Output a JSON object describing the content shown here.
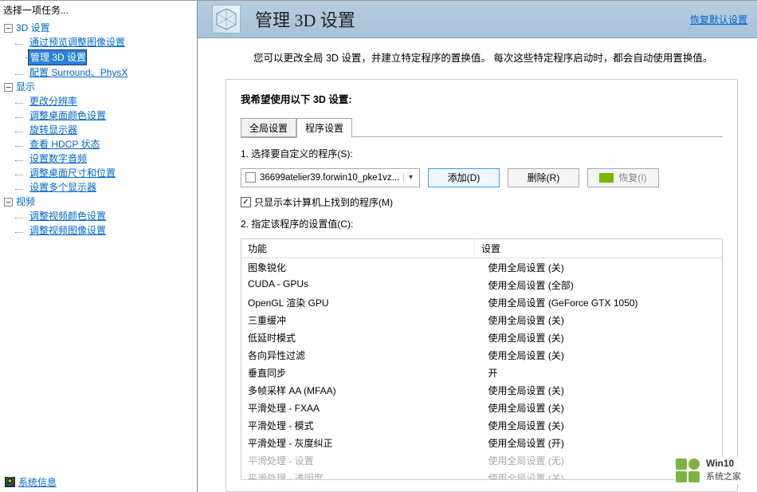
{
  "sidebar": {
    "header": "选择一项任务...",
    "categories": [
      {
        "label": "3D 设置",
        "items": [
          {
            "label": "通过预览调整图像设置"
          },
          {
            "label": "管理 3D 设置",
            "selected": true
          },
          {
            "label": "配置 Surround、PhysX"
          }
        ]
      },
      {
        "label": "显示",
        "items": [
          {
            "label": "更改分辨率"
          },
          {
            "label": "调整桌面颜色设置"
          },
          {
            "label": "旋转显示器"
          },
          {
            "label": "查看 HDCP 状态"
          },
          {
            "label": "设置数字音频"
          },
          {
            "label": "调整桌面尺寸和位置"
          },
          {
            "label": "设置多个显示器"
          }
        ]
      },
      {
        "label": "视频",
        "items": [
          {
            "label": "调整视频颜色设置"
          },
          {
            "label": "调整视频图像设置"
          }
        ]
      }
    ],
    "sysinfo": "系统信息"
  },
  "page": {
    "title": "管理 3D 设置",
    "restore": "恢复默认设置",
    "description": "您可以更改全局 3D 设置，并建立特定程序的置换值。  每次这些特定程序启动时，都会自动使用置换值。"
  },
  "panel": {
    "heading": "我希望使用以下 3D 设置:",
    "tabs": [
      "全局设置",
      "程序设置"
    ],
    "active_tab": 1,
    "step1": "1. 选择要自定义的程序(S):",
    "program": "36699atelier39.forwin10_pke1vz...",
    "btn_add": "添加(D)",
    "btn_remove": "删除(R)",
    "btn_restore": "恢复(I)",
    "checkbox": "只显示本计算机上找到的程序(M)",
    "checkbox_checked": true,
    "step2": "2. 指定该程序的设置值(C):",
    "headers": [
      "功能",
      "设置"
    ],
    "settings": [
      {
        "name": "图象锐化",
        "value": "使用全局设置 (关)"
      },
      {
        "name": "CUDA - GPUs",
        "value": "使用全局设置 (全部)"
      },
      {
        "name": "OpenGL 渲染 GPU",
        "value": "使用全局设置 (GeForce GTX 1050)"
      },
      {
        "name": "三重缓冲",
        "value": "使用全局设置 (关)"
      },
      {
        "name": "低延时模式",
        "value": "使用全局设置 (关)"
      },
      {
        "name": "各向异性过滤",
        "value": "使用全局设置 (关)"
      },
      {
        "name": "垂直同步",
        "value": "开"
      },
      {
        "name": "多帧采样 AA (MFAA)",
        "value": "使用全局设置 (关)"
      },
      {
        "name": "平滑处理 - FXAA",
        "value": "使用全局设置 (关)"
      },
      {
        "name": "平滑处理 - 模式",
        "value": "使用全局设置 (关)"
      },
      {
        "name": "平滑处理 - 灰度纠正",
        "value": "使用全局设置 (开)"
      },
      {
        "name": "平滑处理 - 设置",
        "value": "使用全局设置 (无)",
        "disabled": true
      },
      {
        "name": "平滑处理 - 透明度",
        "value": "使用全局设置 (关)",
        "disabled": true
      }
    ]
  },
  "watermark": {
    "line1": "Win10",
    "line2": "系统之家"
  }
}
